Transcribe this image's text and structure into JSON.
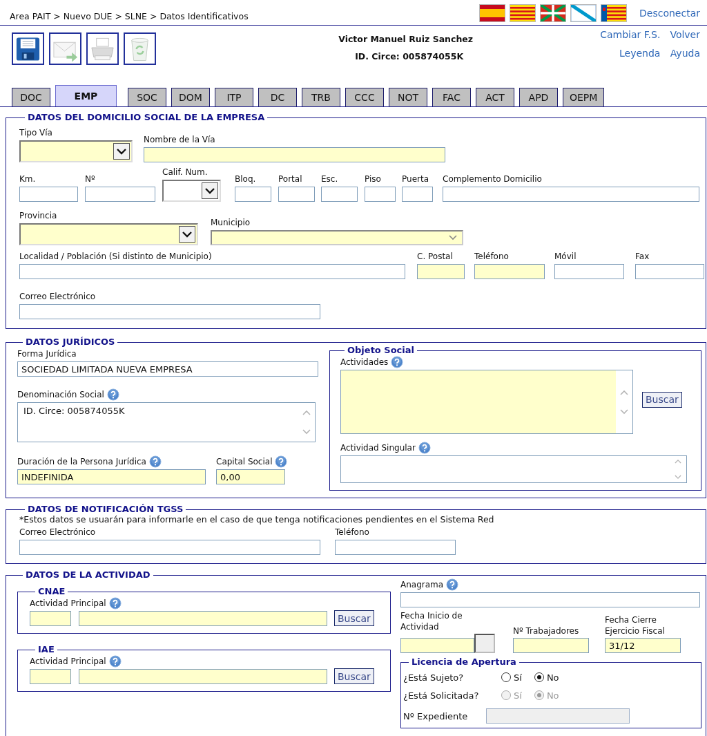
{
  "breadcrumb": "Area PAIT > Nuevo DUE > SLNE > Datos Identificativos",
  "languages": [
    {
      "kind": "es"
    },
    {
      "kind": "ca"
    },
    {
      "kind": "eu"
    },
    {
      "kind": "gl"
    },
    {
      "kind": "va"
    }
  ],
  "logout": "Desconectar",
  "toolbar": [
    {
      "kind": "save",
      "disabled": false
    },
    {
      "kind": "send",
      "disabled": true
    },
    {
      "kind": "print",
      "disabled": true
    },
    {
      "kind": "delete",
      "disabled": true
    }
  ],
  "user": {
    "name": "Victor Manuel Ruiz Sanchez",
    "id": "ID. Circe: 005874055K"
  },
  "nav_links": [
    "Cambiar F.S.",
    "Volver",
    "Leyenda",
    "Ayuda"
  ],
  "tabs": [
    {
      "label": "DOC",
      "selected": false
    },
    {
      "label": "EMP",
      "selected": true
    },
    {
      "label": "SOC",
      "selected": false
    },
    {
      "label": "DOM",
      "selected": false
    },
    {
      "label": "ITP",
      "selected": false
    },
    {
      "label": "DC",
      "selected": false
    },
    {
      "label": "TRB",
      "selected": false
    },
    {
      "label": "CCC",
      "selected": false
    },
    {
      "label": "NOT",
      "selected": false
    },
    {
      "label": "FAC",
      "selected": false
    },
    {
      "label": "ACT",
      "selected": false
    },
    {
      "label": "APD",
      "selected": false
    },
    {
      "label": "OEPM",
      "selected": false
    }
  ],
  "domicilio": {
    "title": "DATOS DEL DOMICILIO SOCIAL DE LA EMPRESA",
    "fields": [
      {
        "kind": "select",
        "label": "Tipo Vía",
        "help": false,
        "required": true,
        "disabled": false
      },
      {
        "kind": "text",
        "label": "Nombre de la Vía",
        "help": false,
        "required": true,
        "disabled": false
      },
      {
        "kind": "text",
        "label": "Km.",
        "help": false,
        "required": false,
        "disabled": false
      },
      {
        "kind": "text",
        "label": "Nº",
        "help": false,
        "required": false,
        "disabled": false
      },
      {
        "kind": "select",
        "label": "Calif. Num.",
        "help": false,
        "required": false,
        "disabled": false
      },
      {
        "kind": "text",
        "label": "Bloq.",
        "help": false,
        "required": false,
        "disabled": false
      },
      {
        "kind": "text",
        "label": "Portal",
        "help": false,
        "required": false,
        "disabled": false
      },
      {
        "kind": "text",
        "label": "Esc.",
        "help": false,
        "required": false,
        "disabled": false
      },
      {
        "kind": "text",
        "label": "Piso",
        "help": false,
        "required": false,
        "disabled": false
      },
      {
        "kind": "text",
        "label": "Puerta",
        "help": false,
        "required": false,
        "disabled": false
      },
      {
        "kind": "text",
        "label": "Complemento Domicilio",
        "help": false,
        "required": false,
        "disabled": false
      },
      {
        "kind": "select",
        "label": "Provincia",
        "help": false,
        "required": true,
        "disabled": false
      },
      {
        "kind": "select",
        "label": "Municipio",
        "help": false,
        "required": true,
        "disabled": true
      },
      {
        "kind": "text",
        "label": "Localidad / Población (Si distinto de Municipio)",
        "help": false,
        "required": false,
        "disabled": false
      },
      {
        "kind": "text",
        "label": "C. Postal",
        "help": false,
        "required": true,
        "disabled": false
      },
      {
        "kind": "text",
        "label": "Teléfono",
        "help": false,
        "required": true,
        "disabled": false
      },
      {
        "kind": "text",
        "label": "Móvil",
        "help": false,
        "required": false,
        "disabled": false
      },
      {
        "kind": "text",
        "label": "Fax",
        "help": false,
        "required": false,
        "disabled": false
      },
      {
        "kind": "text",
        "label": "Correo Electrónico",
        "help": false,
        "required": false,
        "disabled": false
      }
    ]
  },
  "juridicos": {
    "title": "DATOS JURÍDICOS",
    "fields": [
      {
        "kind": "text",
        "label": "Forma Jurídica",
        "help": false,
        "required": false,
        "disabled": false,
        "value": "SOCIEDAD LIMITADA NUEVA EMPRESA"
      },
      {
        "kind": "textarea",
        "label": "Denominación Social",
        "help": true,
        "required": false,
        "disabled": false,
        "value": "ID. Circe: 005874055K"
      },
      {
        "kind": "text",
        "label": "Duración de la Persona Jurídica",
        "help": true,
        "required": true,
        "disabled": false,
        "value": "INDEFINIDA"
      },
      {
        "kind": "text",
        "label": "Capital Social",
        "help": true,
        "required": true,
        "disabled": false,
        "value": "0,00"
      }
    ],
    "objeto_social": {
      "title": "Objeto Social",
      "button": "Buscar",
      "fields": [
        {
          "kind": "textarea",
          "label": "Actividades",
          "help": true,
          "required": true,
          "disabled": false
        },
        {
          "kind": "textarea",
          "label": "Actividad Singular",
          "help": true,
          "required": false,
          "disabled": false
        }
      ]
    }
  },
  "notificacion": {
    "title": "DATOS DE NOTIFICACIÓN TGSS",
    "note": "*Estos datos se usuarán para informarle en el caso de que tenga notificaciones pendientes en el Sistema Red",
    "fields": [
      {
        "kind": "text",
        "label": "Correo Electrónico",
        "help": false,
        "required": false,
        "disabled": false
      },
      {
        "kind": "text",
        "label": "Teléfono",
        "help": false,
        "required": false,
        "disabled": false
      }
    ]
  },
  "actividad": {
    "title": "DATOS DE LA ACTIVIDAD",
    "groups": [
      {
        "title": "CNAE",
        "button": "Buscar",
        "field": {
          "kind": "pair",
          "label": "Actividad Principal",
          "help": true,
          "required": true,
          "disabled": false
        }
      },
      {
        "title": "IAE",
        "button": "Buscar",
        "field": {
          "kind": "pair",
          "label": "Actividad Principal",
          "help": true,
          "required": true,
          "disabled": false
        }
      }
    ],
    "anagrama": {
      "kind": "text",
      "label": "Anagrama",
      "help": true,
      "required": false,
      "disabled": false
    },
    "fields": [
      {
        "kind": "date",
        "label": "Fecha Inicio de Actividad",
        "help": false,
        "required": true,
        "disabled": false
      },
      {
        "kind": "text",
        "label": "Nº Trabajadores",
        "help": false,
        "required": true,
        "disabled": false
      },
      {
        "kind": "text",
        "label": "Fecha Cierre Ejercicio Fiscal",
        "help": false,
        "required": true,
        "disabled": false,
        "value": "31/12"
      }
    ],
    "licencia": {
      "title": "Licencia de Apertura",
      "questions": [
        {
          "label": "¿Está Sujeto?",
          "disabled": false,
          "options": [
            {
              "label": "Sí",
              "selected": false
            },
            {
              "label": "No",
              "selected": true
            }
          ]
        },
        {
          "label": "¿Está Solicitada?",
          "disabled": true,
          "options": [
            {
              "label": "Sí",
              "selected": false
            },
            {
              "label": "No",
              "selected": true
            }
          ]
        }
      ],
      "expediente": {
        "kind": "text",
        "label": "Nº Expediente",
        "help": false,
        "required": false,
        "disabled": true
      }
    }
  }
}
